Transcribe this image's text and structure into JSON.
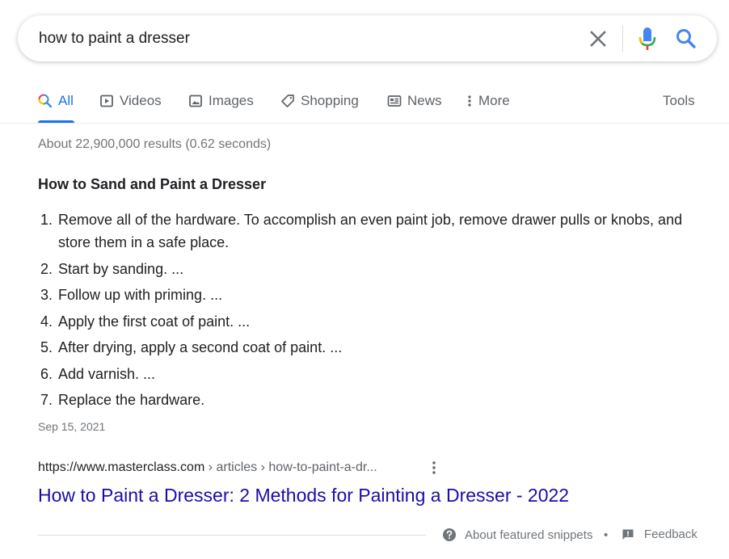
{
  "search": {
    "query": "how to paint a dresser"
  },
  "tabs": [
    {
      "label": "All",
      "icon": "search-icon"
    },
    {
      "label": "Videos",
      "icon": "video-icon"
    },
    {
      "label": "Images",
      "icon": "image-icon"
    },
    {
      "label": "Shopping",
      "icon": "tag-icon"
    },
    {
      "label": "News",
      "icon": "news-icon"
    },
    {
      "label": "More",
      "icon": "more-vert-icon"
    }
  ],
  "tools_label": "Tools",
  "result_stats": "About 22,900,000 results (0.62 seconds)",
  "snippet": {
    "heading": "How to Sand and Paint a Dresser",
    "steps": [
      {
        "num": "1.",
        "text": "Remove all of the hardware. To accomplish an even paint job, remove drawer pulls or knobs, and store them in a safe place."
      },
      {
        "num": "2.",
        "text": "Start by sanding. ..."
      },
      {
        "num": "3.",
        "text": "Follow up with priming. ..."
      },
      {
        "num": "4.",
        "text": "Apply the first coat of paint. ..."
      },
      {
        "num": "5.",
        "text": "After drying, apply a second coat of paint. ..."
      },
      {
        "num": "6.",
        "text": "Add varnish. ..."
      },
      {
        "num": "7.",
        "text": "Replace the hardware."
      }
    ],
    "date": "Sep 15, 2021"
  },
  "result": {
    "site": "https://www.masterclass.com",
    "breadcrumb": " › articles › how-to-paint-a-dr...",
    "title": "How to Paint a Dresser: 2 Methods for Painting a Dresser - 2022"
  },
  "footer": {
    "about_label": "About featured snippets",
    "separator": "•",
    "feedback_label": "Feedback"
  },
  "colors": {
    "accent": "#1a73e8",
    "link": "#1a0dab",
    "text": "#202124",
    "muted": "#70757a"
  }
}
